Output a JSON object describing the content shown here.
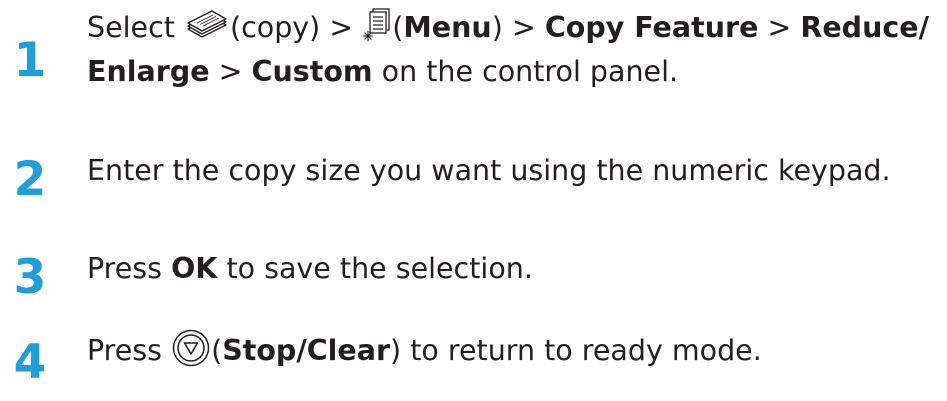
{
  "steps": [
    {
      "number": "1",
      "l1_a": "Select ",
      "l1_b": "(copy) > ",
      "l1_c": "(",
      "l1_d": "Menu",
      "l1_e": ") > ",
      "l1_f": "Copy Feature",
      "l1_g": " > ",
      "l1_h": "Reduce/",
      "l2_a": "Enlarge",
      "l2_b": " > ",
      "l2_c": "Custom",
      "l2_d": " on the control panel.",
      "icons": [
        "copy-icon",
        "menu-icon"
      ]
    },
    {
      "number": "2",
      "text": "Enter the copy size you want using the numeric keypad."
    },
    {
      "number": "3",
      "a": "Press ",
      "b": "OK",
      "c": " to save the selection."
    },
    {
      "number": "4",
      "a": "Press ",
      "b": "(",
      "c": "Stop/Clear",
      "d": ") to return to ready mode.",
      "icons": [
        "stop-clear-icon"
      ]
    }
  ],
  "colors": {
    "step_number": "#1f9fd9",
    "text": "#231f20"
  }
}
